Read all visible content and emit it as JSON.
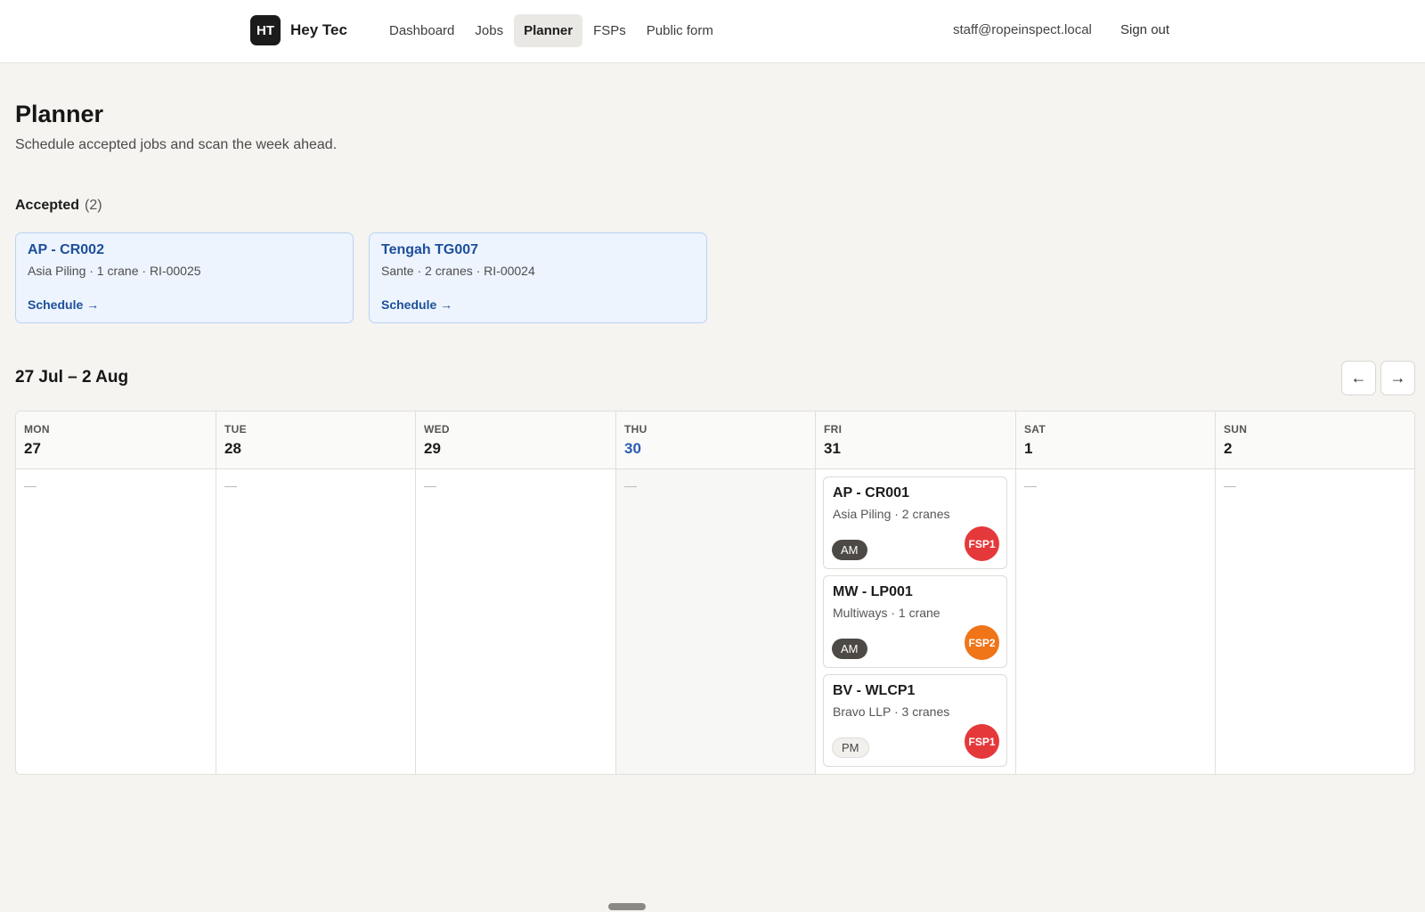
{
  "header": {
    "logo_text": "HT",
    "app_name": "Hey Tec",
    "nav": [
      {
        "label": "Dashboard",
        "active": false
      },
      {
        "label": "Jobs",
        "active": false
      },
      {
        "label": "Planner",
        "active": true
      },
      {
        "label": "FSPs",
        "active": false
      },
      {
        "label": "Public form",
        "active": false
      }
    ],
    "user_email": "staff@ropeinspect.local",
    "sign_out_label": "Sign out"
  },
  "page": {
    "title": "Planner",
    "subtitle": "Schedule accepted jobs and scan the week ahead."
  },
  "accepted": {
    "label": "Accepted",
    "count": "(2)",
    "items": [
      {
        "title": "AP - CR002",
        "meta": "Asia Piling · 1 crane · RI-00025",
        "action": "Schedule →"
      },
      {
        "title": "Tengah TG007",
        "meta": "Sante · 2 cranes · RI-00024",
        "action": "Schedule →"
      }
    ]
  },
  "week": {
    "range": "27 Jul – 2 Aug",
    "prev_icon": "←",
    "next_icon": "→",
    "empty_marker": "—",
    "days": [
      {
        "name": "MON",
        "num": "27",
        "today": false,
        "jobs": []
      },
      {
        "name": "TUE",
        "num": "28",
        "today": false,
        "jobs": []
      },
      {
        "name": "WED",
        "num": "29",
        "today": false,
        "jobs": []
      },
      {
        "name": "THU",
        "num": "30",
        "today": true,
        "jobs": []
      },
      {
        "name": "FRI",
        "num": "31",
        "today": false,
        "jobs": [
          {
            "title": "AP - CR001",
            "meta": "Asia Piling · 2 cranes",
            "slot": "AM",
            "fsp": "FSP1",
            "fsp_color": "#e5383b"
          },
          {
            "title": "MW - LP001",
            "meta": "Multiways · 1 crane",
            "slot": "AM",
            "fsp": "FSP2",
            "fsp_color": "#f07418"
          },
          {
            "title": "BV - WLCP1",
            "meta": "Bravo LLP · 3 cranes",
            "slot": "PM",
            "fsp": "FSP1",
            "fsp_color": "#e5383b"
          }
        ]
      },
      {
        "name": "SAT",
        "num": "1",
        "today": false,
        "jobs": []
      },
      {
        "name": "SUN",
        "num": "2",
        "today": false,
        "jobs": []
      }
    ]
  }
}
